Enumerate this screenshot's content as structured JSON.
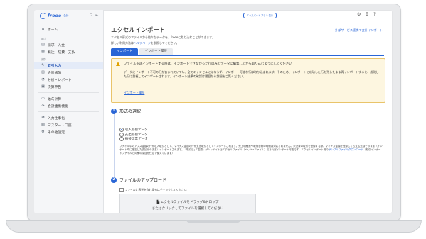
{
  "sidebar": {
    "logo_text": "freee",
    "logo_sub": "会計",
    "tool_icons": [
      "panel-icon",
      "collapse-icon"
    ],
    "home": "ホーム",
    "sections": {
      "s1": "取引",
      "s2": "決算"
    },
    "items": [
      {
        "label": "請求・入金",
        "icon": "invoice-icon"
      },
      {
        "label": "発注・経費・支払",
        "icon": "payment-icon"
      },
      {
        "label": "取引入力",
        "icon": "entry-icon"
      },
      {
        "label": "会計帳簿",
        "icon": "book-icon"
      },
      {
        "label": "分析・レポート",
        "icon": "report-icon"
      },
      {
        "label": "決算申告",
        "icon": "tax-icon"
      },
      {
        "label": "給与計算",
        "icon": "salary-icon"
      },
      {
        "label": "会計連携機能",
        "icon": "link-icon"
      },
      {
        "label": "入力仕事化",
        "icon": "automation-icon"
      },
      {
        "label": "マスター・口座",
        "icon": "master-icon"
      },
      {
        "label": "その他設定",
        "icon": "settings-icon"
      }
    ]
  },
  "topbar": {
    "pill": "エキスパート プラン 表示"
  },
  "page": {
    "title": "エクセルインポート",
    "desc1": "エクセル形式のファイルから勘々なデータを、freeeに取り込むことができます。",
    "desc2_prefix": "詳しい利用方法は",
    "desc2_link": "ヘルプページ",
    "desc2_suffix": "を参照してください。",
    "right_link": "外部サービス連携で会計インポート",
    "tabs": [
      "インポート",
      "インポート履歴"
    ]
  },
  "warning": {
    "title": "ファイルを再インポートする際は、インポートできなかった行のみのデータに編集してから取り込むようにしてください",
    "body": "データにインポート不可の行が含まれていても、全てキャンセルにはならず、インポート可能な行は取り込まれます。そのため、インポートに成功した行を残したまま再インポートすると、成功した行は重複してインポートされます。インポート結果の確認は履歴から詳細をご覧ください。",
    "link": "インポート履歴"
  },
  "step1": {
    "num": "1",
    "title": "形式の選択",
    "options": [
      "収入取引データ",
      "支出取引データ",
      "振替伝票データ"
    ],
    "selected": 0,
    "note": "ファイル中のアプス金額の行が収入取引として、マイナス金額の行が支出取引としてインポートされます。売上明細票や取得台帳の明細は対応されません。未決済の取引を登録する際、マイナス金額を登録しても支払元はそのまま（インポート時に指定した支払元のまま）インポートされます。「取引日」「金額」がヘッドイトはエクセルファイル（xls,xlsxファイル）であればインポート可能です。エクセルインポート用の",
    "note_link": "サンプルファイルダウンロード",
    "note_suffix": "（取引インポートファイルと同様の項目を任意で使えています）"
  },
  "step2": {
    "num": "2",
    "title": "ファイルのアップロード",
    "checkbox": "ファイルに表述を含む場合はチェックしてください",
    "drop_l1": "エクセルファイルをドラッグ&ドロップ",
    "drop_l2": "またはクリックしてファイルを選択してください"
  }
}
